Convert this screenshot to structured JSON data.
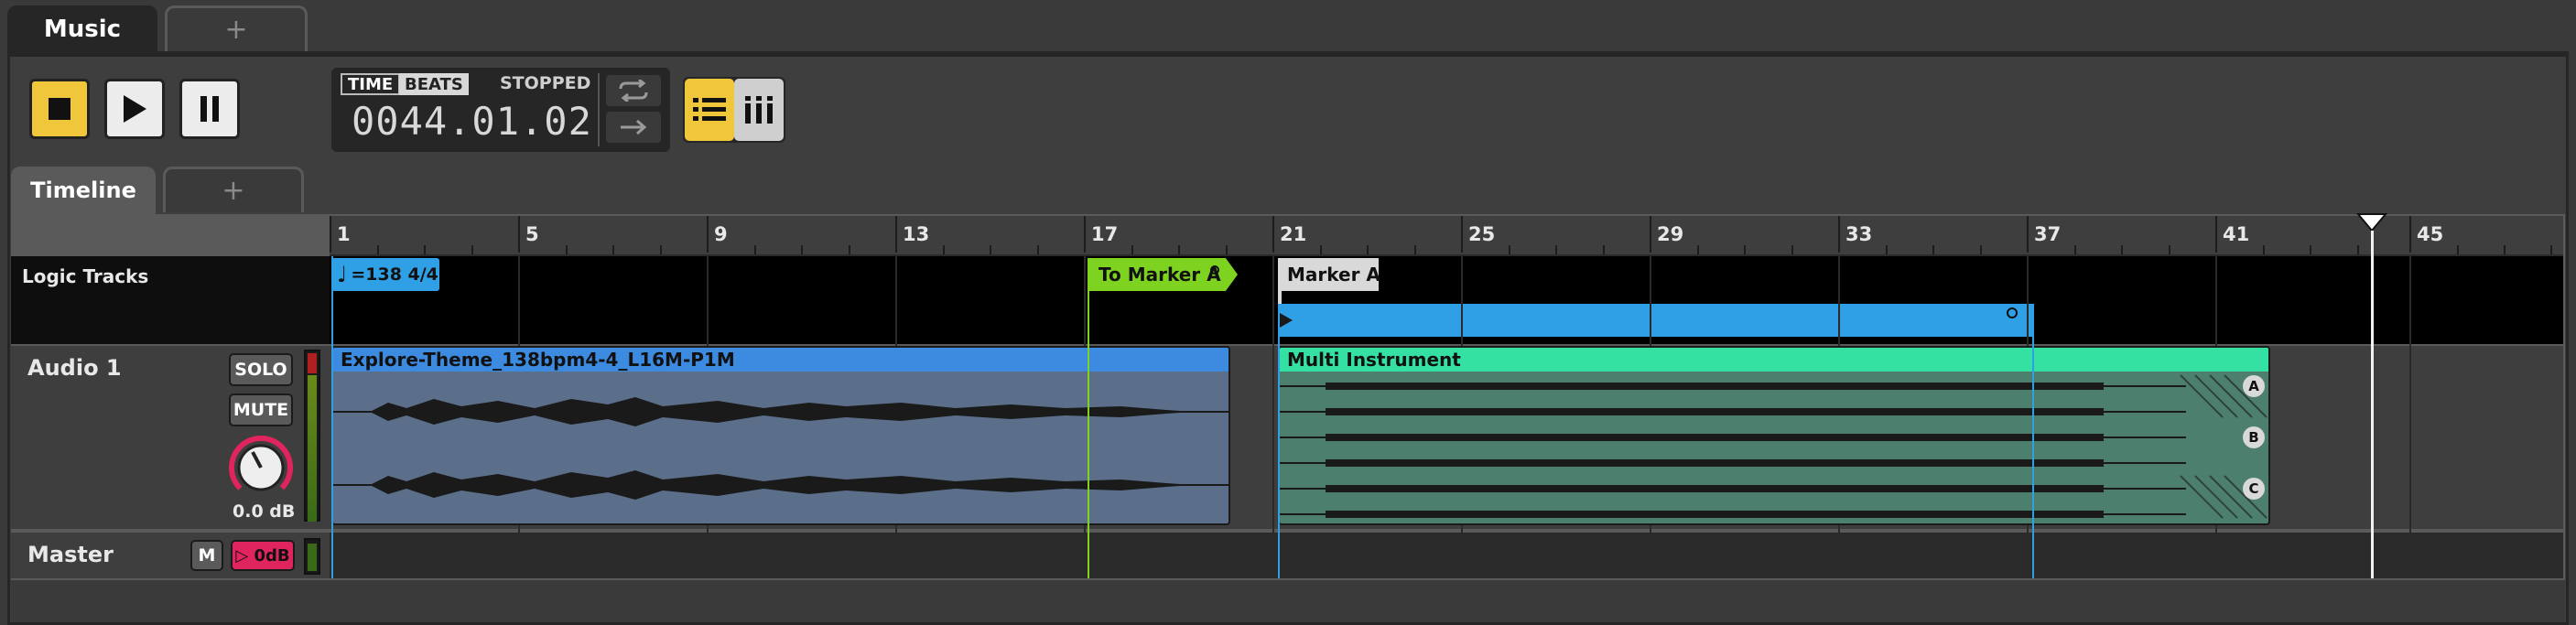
{
  "window": {
    "tabs": [
      {
        "label": "Music"
      }
    ],
    "add_tab_label": "+"
  },
  "transport": {
    "time_label": "TIME",
    "beats_label": "BEATS",
    "status": "STOPPED",
    "position": "0044.01.02"
  },
  "timeline": {
    "tab_label": "Timeline",
    "add_tab_label": "+",
    "ruler_labels": [
      "1",
      "5",
      "9",
      "13",
      "17",
      "21",
      "25",
      "29",
      "33",
      "37",
      "41",
      "45"
    ]
  },
  "logic_tracks": {
    "label": "Logic Tracks",
    "tempo_marker": "=138 4/4",
    "to_marker": "To Marker A",
    "marker": "Marker A"
  },
  "audio_track": {
    "name": "Audio 1",
    "solo_label": "SOLO",
    "mute_label": "MUTE",
    "volume": "0.0 dB",
    "clips": [
      {
        "title": "Explore-Theme_138bpm4-4_L16M-P1M",
        "color": "#3d8be0"
      },
      {
        "title": "Multi Instrument",
        "color": "#35e0a3",
        "lanes": [
          "A",
          "B",
          "C"
        ]
      }
    ]
  },
  "master_track": {
    "name": "Master",
    "mute_label": "M",
    "limiter_label": "▷ 0dB"
  },
  "colors": {
    "accent_yellow": "#f0c63a",
    "marker_green": "#7ed321",
    "region_blue": "#2fa0e6",
    "knob_red": "#e0245e"
  }
}
